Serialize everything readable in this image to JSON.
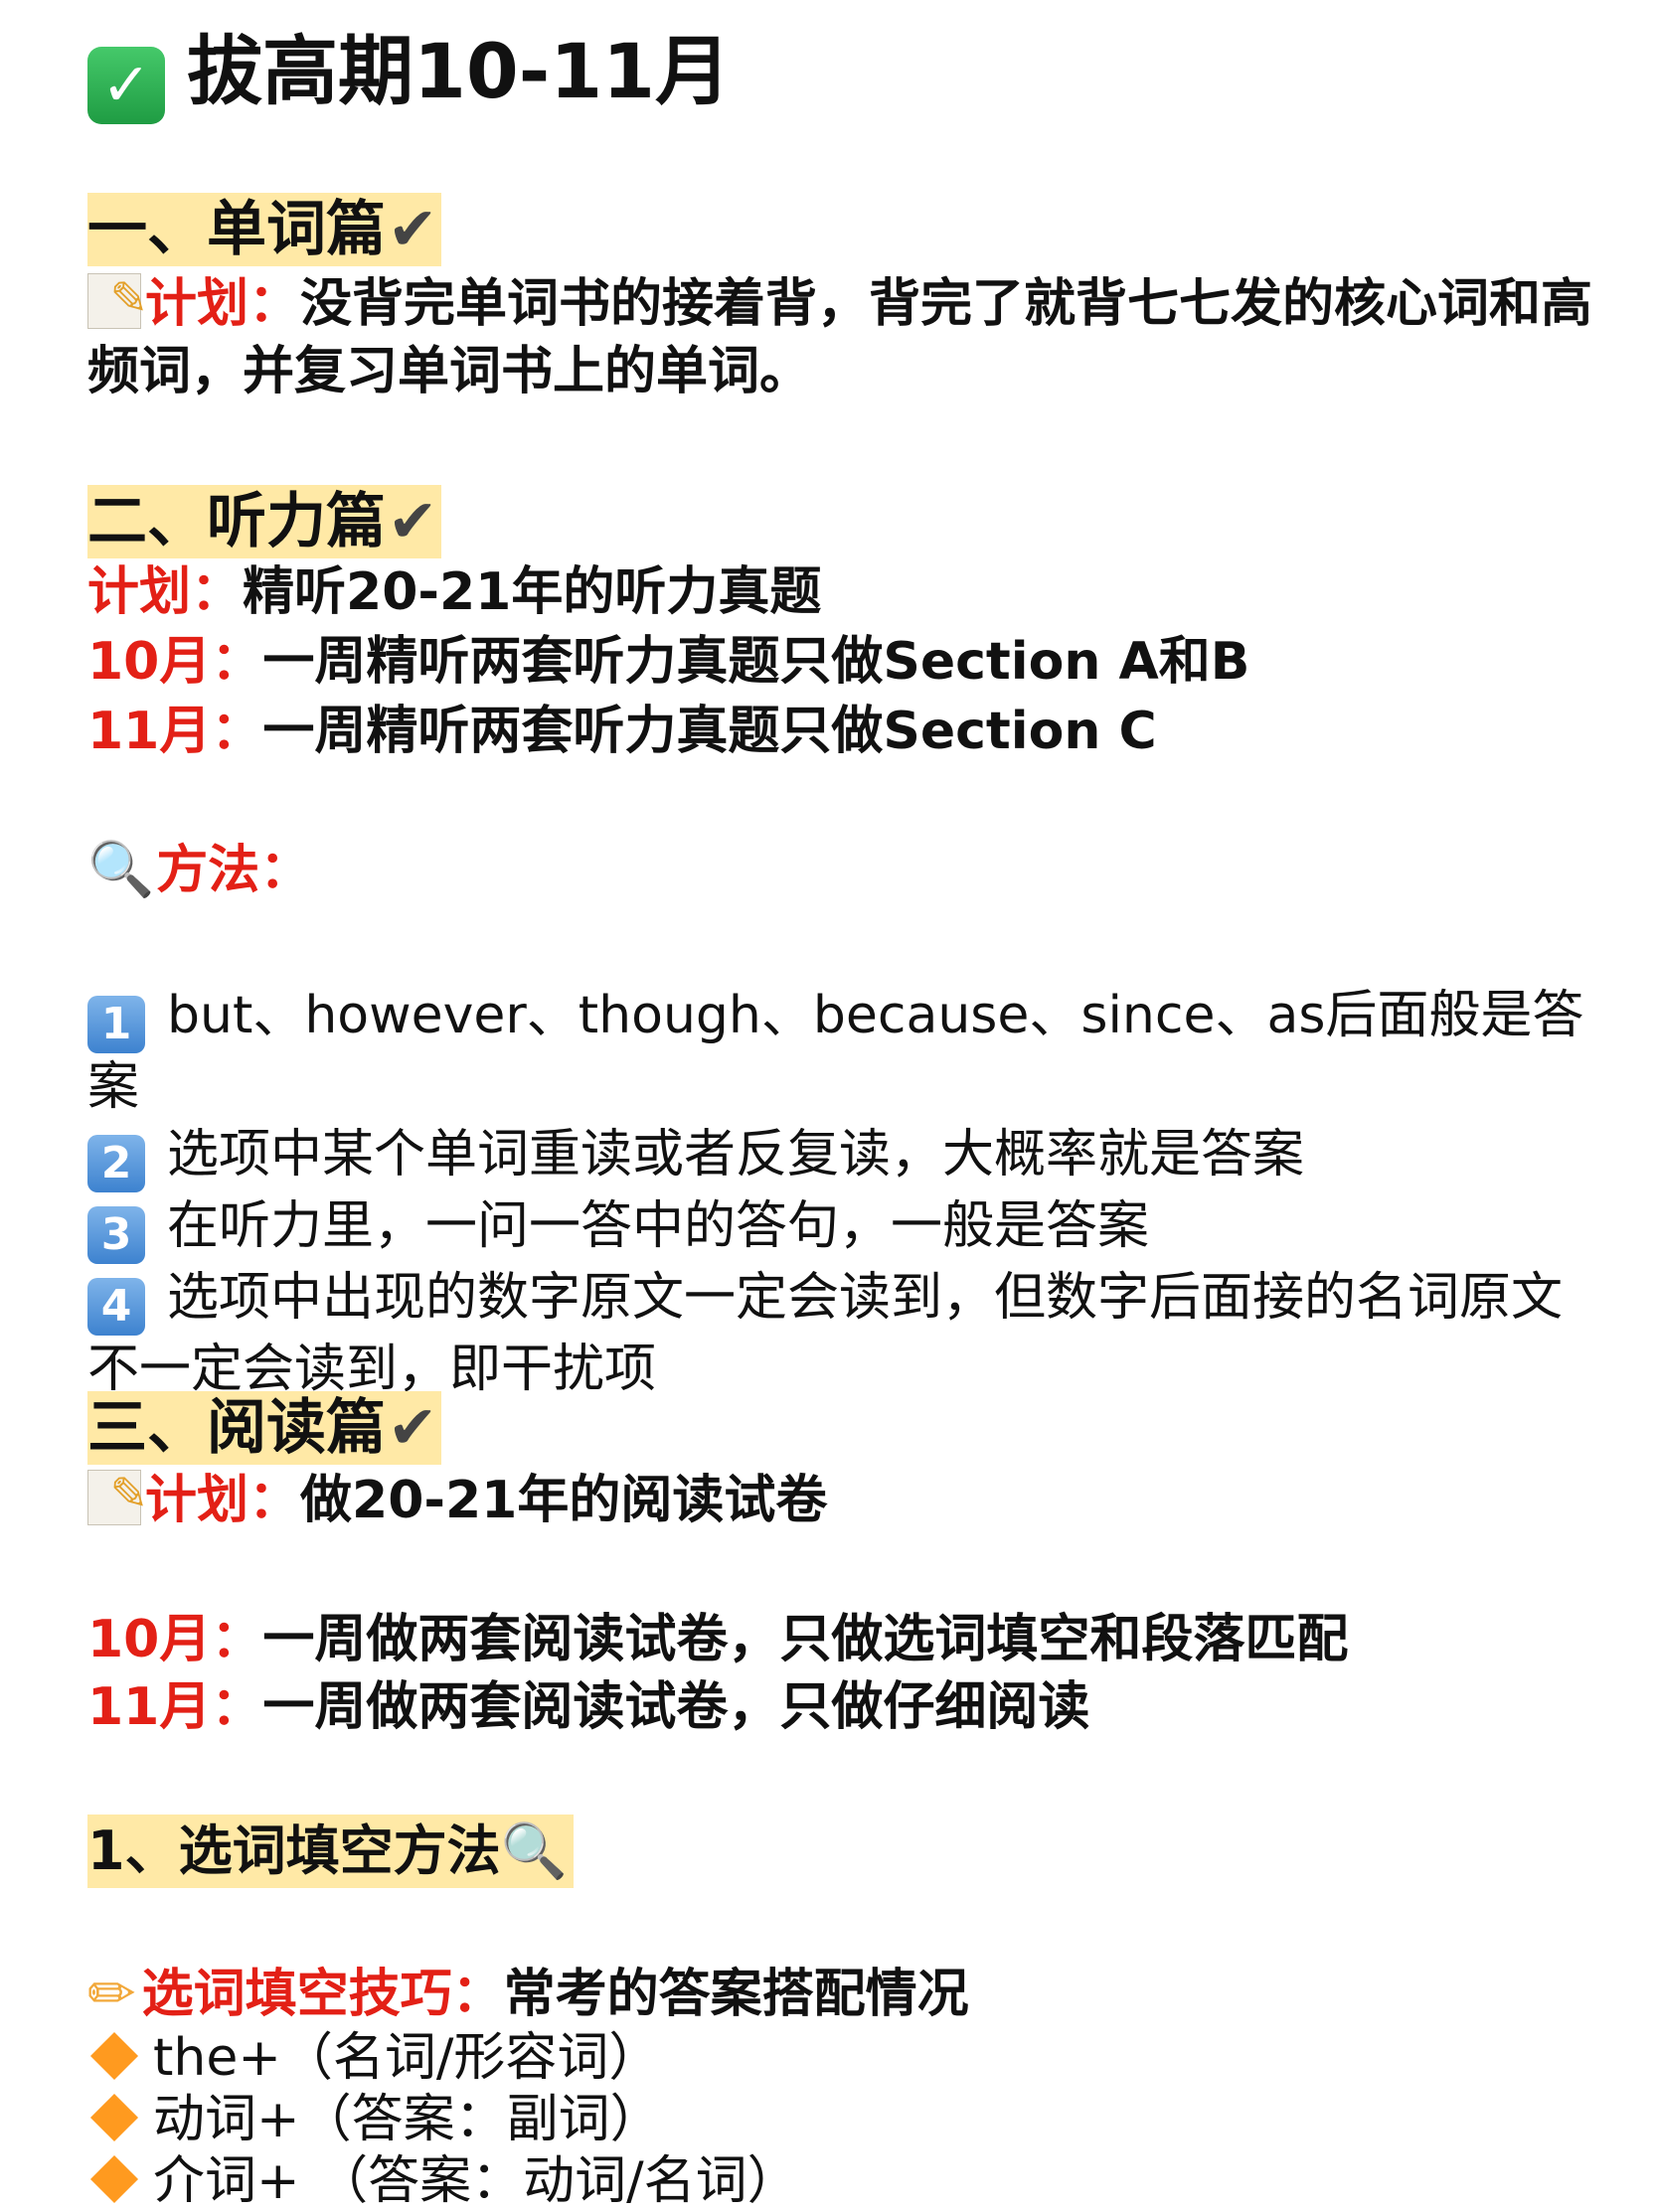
{
  "title": {
    "icon": "check-mark-button-icon",
    "text": "拔高期10-11月"
  },
  "sections": {
    "vocab": {
      "heading": "一、单词篇",
      "plan_label": "计划：",
      "plan_text": "没背完单词书的接着背，背完了就背七七发的核心词和高频词，并复习单词书上的单词。"
    },
    "listening": {
      "heading": "二、听力篇",
      "plan_label": "计划：",
      "plan_text": "精听20-21年的听力真题",
      "oct_label": "10月：",
      "oct_text": "一周精听两套听力真题只做Section A和B",
      "nov_label": "11月：",
      "nov_text": "一周精听两套听力真题只做Section C",
      "method_label": "方法：",
      "tips": [
        {
          "num": "1",
          "text": "but、however、though、because、since、as后面般是答案"
        },
        {
          "num": "2",
          "text": "选项中某个单词重读或者反复读，大概率就是答案"
        },
        {
          "num": "3",
          "text": "在听力里，一问一答中的答句，一般是答案"
        },
        {
          "num": "4",
          "text": "选项中出现的数字原文一定会读到，但数字后面接的名词原文不一定会读到，即干扰项"
        }
      ]
    },
    "reading": {
      "heading": "三、阅读篇",
      "plan_label": "计划：",
      "plan_text": "做20-21年的阅读试卷",
      "oct_label": "10月：",
      "oct_text": "一周做两套阅读试卷，只做选词填空和段落匹配",
      "nov_label": "11月：",
      "nov_text": "一周做两套阅读试卷，只做仔细阅读",
      "sub_heading": "1、选词填空方法",
      "skill_label": "选词填空技巧：",
      "skill_text": "常考的答案搭配情况",
      "items": [
        "the+（名词/形容词）",
        "动词+（答案：副词）",
        "介词+ （答案：动词/名词）"
      ]
    }
  },
  "colors": {
    "accent_red": "#e32016",
    "highlight": "#ffe9a6",
    "diamond": "#ff9a1f",
    "keycap": "#3d82cf"
  }
}
